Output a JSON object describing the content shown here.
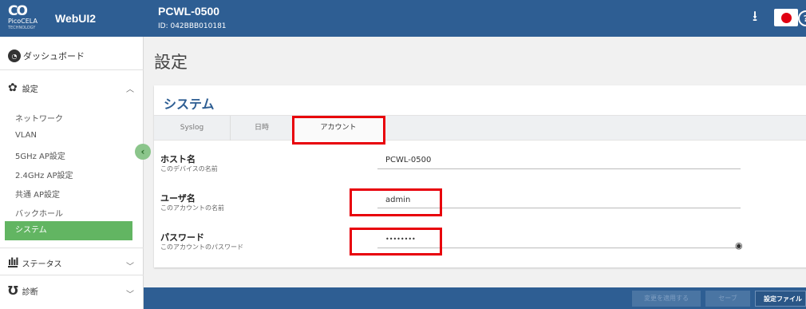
{
  "brand": {
    "logo_glyph": "CO",
    "company": "PicoCELA",
    "subtitle": "TECHNOLOGY",
    "app_name": "WebUI2"
  },
  "topbar": {
    "device_name": "PCWL-0500",
    "device_id": "ID: 042BBB010181",
    "download_icon": "download-icon",
    "language_flag": "japan-flag",
    "help_icon": "help-icon"
  },
  "sidebar": {
    "dashboard": {
      "label": "ダッシュボード",
      "icon": "dashboard-icon"
    },
    "settings": {
      "label": "設定",
      "icon": "gear-icon",
      "expanded": true,
      "items": [
        {
          "label": "ネットワーク",
          "active": false
        },
        {
          "label": "VLAN",
          "active": false
        },
        {
          "label": "5GHz AP設定",
          "active": false
        },
        {
          "label": "2.4GHz AP設定",
          "active": false
        },
        {
          "label": "共通 AP設定",
          "active": false
        },
        {
          "label": "バックホール",
          "active": false
        },
        {
          "label": "システム",
          "active": true
        }
      ]
    },
    "status": {
      "label": "ステータス",
      "icon": "chart-icon"
    },
    "diagnosis": {
      "label": "診断",
      "icon": "stethoscope-icon"
    },
    "collapse_icon": "chevron-left-icon"
  },
  "main": {
    "page_title": "設定",
    "card_title": "システム",
    "tabs": [
      {
        "label": "Syslog",
        "active": false
      },
      {
        "label": "日時",
        "active": false
      },
      {
        "label": "アカウント",
        "active": true
      }
    ],
    "fields": {
      "hostname": {
        "label": "ホスト名",
        "desc": "このデバイスの名前",
        "value": "PCWL-0500"
      },
      "username": {
        "label": "ユーザ名",
        "desc": "このアカウントの名前",
        "value": "admin"
      },
      "password": {
        "label": "パスワード",
        "desc": "このアカウントのパスワード",
        "value": "••••••••"
      }
    }
  },
  "bottombar": {
    "apply_label": "変更を適用する",
    "save_label": "セーブ",
    "config_label": "設定ファイル"
  },
  "colors": {
    "header": "#2e5e93",
    "active_nav": "#62b562",
    "highlight": "#e8000b"
  }
}
